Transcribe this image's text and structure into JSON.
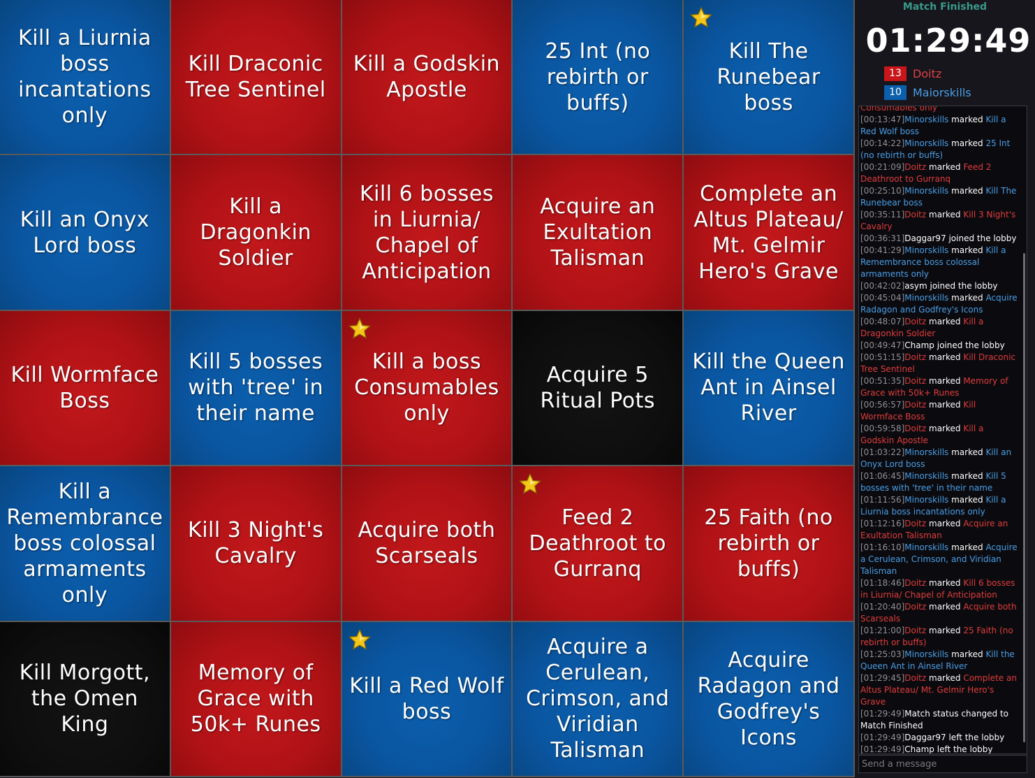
{
  "board": [
    {
      "text": "Kill a Liurnia boss incantations only",
      "color": "blue",
      "star": false
    },
    {
      "text": "Kill Draconic Tree Sentinel",
      "color": "red",
      "star": false
    },
    {
      "text": "Kill a Godskin Apostle",
      "color": "red",
      "star": false
    },
    {
      "text": "25 Int (no rebirth or buffs)",
      "color": "blue",
      "star": false
    },
    {
      "text": "Kill The Runebear boss",
      "color": "blue",
      "star": true
    },
    {
      "text": "Kill an Onyx Lord boss",
      "color": "blue",
      "star": false
    },
    {
      "text": "Kill a Dragonkin Soldier",
      "color": "red",
      "star": false
    },
    {
      "text": "Kill 6 bosses in Liurnia/ Chapel of Anticipation",
      "color": "red",
      "star": false
    },
    {
      "text": "Acquire an Exultation Talisman",
      "color": "red",
      "star": false
    },
    {
      "text": "Complete an Altus Plateau/ Mt. Gelmir Hero's Grave",
      "color": "red",
      "star": false
    },
    {
      "text": "Kill Wormface Boss",
      "color": "red",
      "star": false
    },
    {
      "text": "Kill 5 bosses with 'tree' in their name",
      "color": "blue",
      "star": false
    },
    {
      "text": "Kill a boss Consumables only",
      "color": "red",
      "star": true
    },
    {
      "text": "Acquire 5 Ritual Pots",
      "color": "black",
      "star": false
    },
    {
      "text": "Kill the Queen Ant in Ainsel River",
      "color": "blue",
      "star": false
    },
    {
      "text": "Kill a Remembrance boss colossal armaments only",
      "color": "blue",
      "star": false
    },
    {
      "text": "Kill 3 Night's Cavalry",
      "color": "red",
      "star": false
    },
    {
      "text": "Acquire both Scarseals",
      "color": "red",
      "star": false
    },
    {
      "text": "Feed 2 Deathroot to Gurranq",
      "color": "red",
      "star": true
    },
    {
      "text": "25 Faith (no rebirth or buffs)",
      "color": "red",
      "star": false
    },
    {
      "text": "Kill Morgott, the Omen King",
      "color": "black",
      "star": false
    },
    {
      "text": "Memory of Grace with 50k+ Runes",
      "color": "red",
      "star": false
    },
    {
      "text": "Kill a Red Wolf boss",
      "color": "blue",
      "star": true
    },
    {
      "text": "Acquire a Cerulean, Crimson, and Viridian Talisman",
      "color": "blue",
      "star": false
    },
    {
      "text": "Acquire Radagon and Godfrey's Icons",
      "color": "blue",
      "star": false
    }
  ],
  "status": "Match Finished",
  "timer": "01:29:49",
  "players": [
    {
      "score": "13",
      "name": "Doitz",
      "color": "#c8161a"
    },
    {
      "score": "10",
      "name": "Maiorskills",
      "color": "#0b5fad"
    }
  ],
  "chat": [
    {
      "ts": "",
      "user": "",
      "action": "",
      "goal": "Consumables only",
      "team": "r"
    },
    {
      "ts": "[00:13:47]",
      "user": "Minorskills",
      "action": " marked ",
      "goal": "Kill a Red Wolf boss",
      "team": "b"
    },
    {
      "ts": "[00:14:22]",
      "user": "Minorskills",
      "action": " marked ",
      "goal": "25 Int (no rebirth or buffs)",
      "team": "b"
    },
    {
      "ts": "[00:21:09]",
      "user": "Doitz",
      "action": " marked ",
      "goal": "Feed 2 Deathroot to Gurranq",
      "team": "r"
    },
    {
      "ts": "[00:25:10]",
      "user": "Minorskills",
      "action": " marked ",
      "goal": "Kill The Runebear boss",
      "team": "b"
    },
    {
      "ts": "[00:35:11]",
      "user": "Doitz",
      "action": " marked ",
      "goal": "Kill 3 Night's Cavalry",
      "team": "r"
    },
    {
      "ts": "[00:36:31]",
      "user": "Daggar97",
      "action": " joined the lobby",
      "goal": "",
      "team": "n"
    },
    {
      "ts": "[00:41:29]",
      "user": "Minorskills",
      "action": " marked ",
      "goal": "Kill a Remembrance boss colossal armaments only",
      "team": "b"
    },
    {
      "ts": "[00:42:02]",
      "user": "asym",
      "action": " joined the lobby",
      "goal": "",
      "team": "n"
    },
    {
      "ts": "[00:45:04]",
      "user": "Minorskills",
      "action": " marked ",
      "goal": "Acquire Radagon and Godfrey's Icons",
      "team": "b"
    },
    {
      "ts": "[00:48:07]",
      "user": "Doitz",
      "action": " marked ",
      "goal": "Kill a Dragonkin Soldier",
      "team": "r"
    },
    {
      "ts": "[00:49:47]",
      "user": "Champ",
      "action": " joined the lobby",
      "goal": "",
      "team": "n"
    },
    {
      "ts": "[00:51:15]",
      "user": "Doitz",
      "action": " marked ",
      "goal": "Kill Draconic Tree Sentinel",
      "team": "r"
    },
    {
      "ts": "[00:51:35]",
      "user": "Doitz",
      "action": " marked ",
      "goal": "Memory of Grace with 50k+ Runes",
      "team": "r"
    },
    {
      "ts": "[00:56:57]",
      "user": "Doitz",
      "action": " marked ",
      "goal": "Kill Wormface Boss",
      "team": "r"
    },
    {
      "ts": "[00:59:58]",
      "user": "Doitz",
      "action": " marked ",
      "goal": "Kill a Godskin Apostle",
      "team": "r"
    },
    {
      "ts": "[01:03:22]",
      "user": "Minorskills",
      "action": " marked ",
      "goal": "Kill an Onyx Lord boss",
      "team": "b"
    },
    {
      "ts": "[01:06:45]",
      "user": "Minorskills",
      "action": " marked ",
      "goal": "Kill 5 bosses with 'tree' in their name",
      "team": "b"
    },
    {
      "ts": "[01:11:56]",
      "user": "Minorskills",
      "action": " marked ",
      "goal": "Kill a Liurnia boss incantations only",
      "team": "b"
    },
    {
      "ts": "[01:12:16]",
      "user": "Doitz",
      "action": " marked ",
      "goal": "Acquire an Exultation Talisman",
      "team": "r"
    },
    {
      "ts": "[01:16:10]",
      "user": "Minorskills",
      "action": " marked ",
      "goal": "Acquire a Cerulean, Crimson, and Viridian Talisman",
      "team": "b"
    },
    {
      "ts": "[01:18:46]",
      "user": "Doitz",
      "action": " marked ",
      "goal": "Kill 6 bosses in Liurnia/ Chapel of Anticipation",
      "team": "r"
    },
    {
      "ts": "[01:20:40]",
      "user": "Doitz",
      "action": " marked ",
      "goal": "Acquire both Scarseals",
      "team": "r"
    },
    {
      "ts": "[01:21:00]",
      "user": "Doitz",
      "action": " marked ",
      "goal": "25 Faith (no rebirth or buffs)",
      "team": "r"
    },
    {
      "ts": "[01:25:03]",
      "user": "Minorskills",
      "action": " marked ",
      "goal": "Kill the Queen Ant in Ainsel River",
      "team": "b"
    },
    {
      "ts": "[01:29:45]",
      "user": "Doitz",
      "action": " marked ",
      "goal": "Complete an Altus Plateau/ Mt. Gelmir Hero's Grave",
      "team": "r"
    },
    {
      "ts": "[01:29:49]",
      "user": "",
      "action": "Match status changed to ",
      "goal": "Match Finished",
      "team": "g"
    },
    {
      "ts": "[01:29:49]",
      "user": "Daggar97",
      "action": " left the lobby",
      "goal": "",
      "team": "n"
    },
    {
      "ts": "[01:29:49]",
      "user": "Champ",
      "action": " left the lobby",
      "goal": "",
      "team": "n"
    }
  ],
  "chat_input": {
    "placeholder": "Send a message"
  },
  "colors": {
    "red": "#b01216",
    "blue": "#0a55a0",
    "black": "#0e0e0e",
    "status": "#3a9a8a"
  },
  "icons": {
    "star": "star-icon"
  }
}
